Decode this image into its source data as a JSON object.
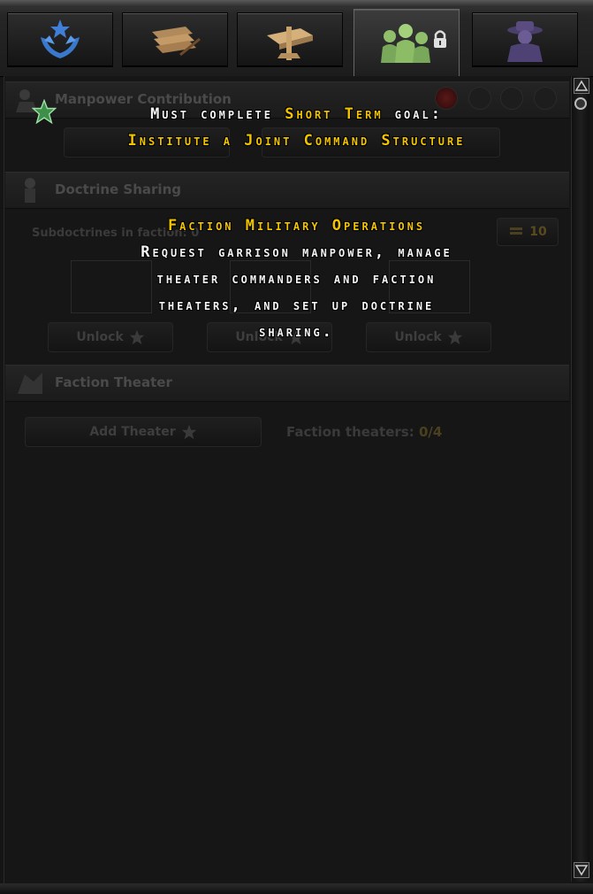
{
  "tabs": [
    {
      "icon": "star-hands-icon"
    },
    {
      "icon": "documents-icon"
    },
    {
      "icon": "map-table-icon"
    },
    {
      "icon": "soldiers-icon",
      "active": true,
      "locked": true
    },
    {
      "icon": "spy-icon"
    }
  ],
  "sections": {
    "manpower": {
      "title": "Manpower Contribution"
    },
    "doctrine": {
      "title": "Doctrine Sharing",
      "subdoctrines_label": "Subdoctrines in faction: 0",
      "cost": "10",
      "unlock_buttons": [
        "Unlock",
        "Unlock",
        "Unlock"
      ]
    },
    "theater": {
      "title": "Faction Theater",
      "add_theater_label": "Add Theater",
      "faction_theaters_label": "Faction theaters:",
      "faction_theaters_value": "0/4"
    }
  },
  "tooltip": {
    "line1_prefix": "Must complete",
    "line1_highlight": "Short Term",
    "line1_suffix": "goal:",
    "goal_name": "Institute a Joint Command Structure",
    "heading": "Faction Military Operations",
    "description_lines": [
      "Request garrison manpower, manage",
      "theater commanders and faction",
      "theaters, and set up doctrine",
      "sharing."
    ]
  },
  "colors": {
    "highlight": "#f2c400",
    "text": "#f4f4f4",
    "background": "#151515"
  }
}
